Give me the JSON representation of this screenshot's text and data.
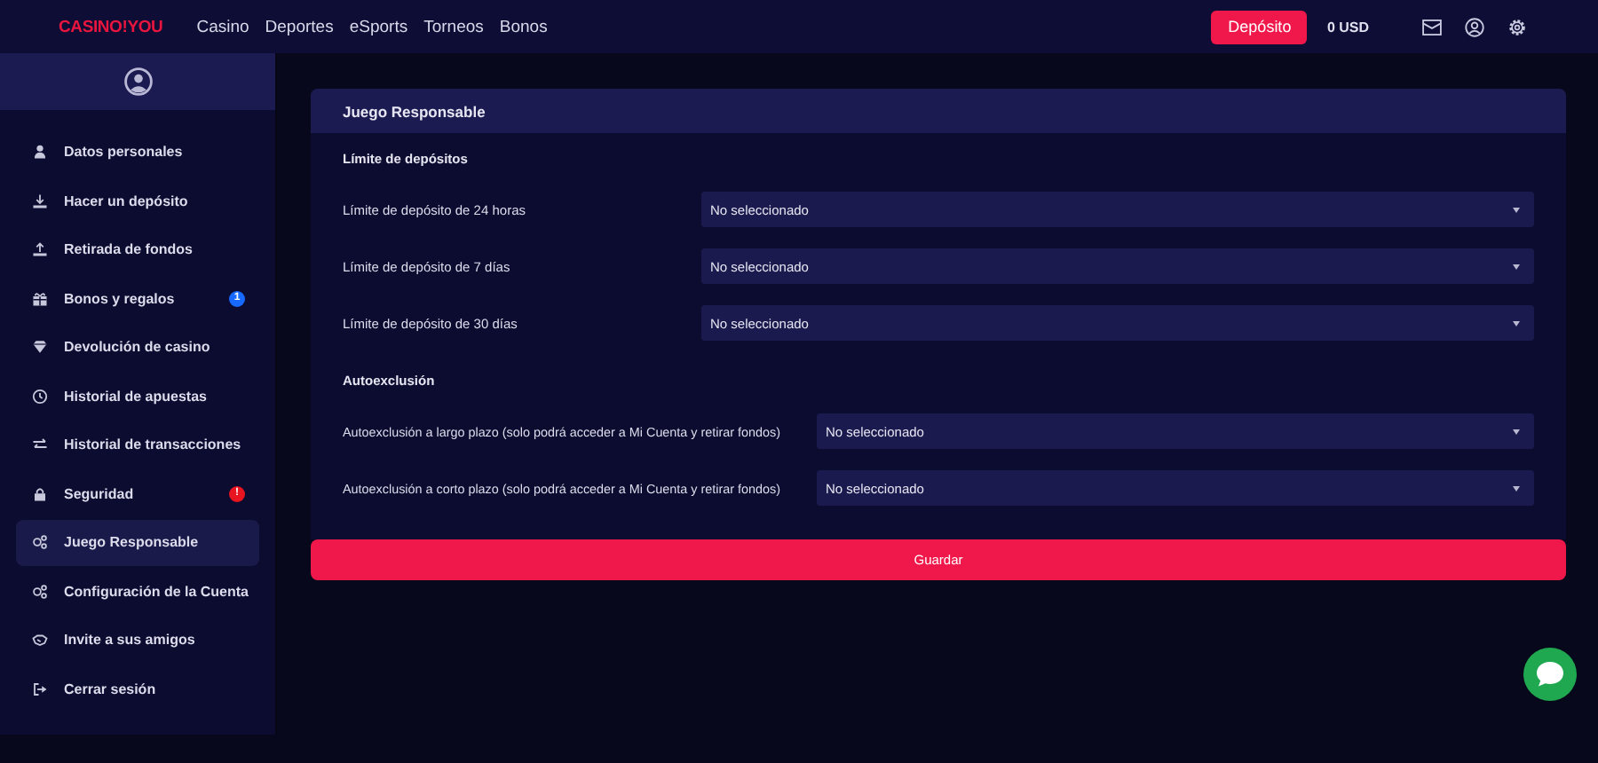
{
  "header": {
    "logo": "CASINO!YOU",
    "nav": [
      "Casino",
      "Deportes",
      "eSports",
      "Torneos",
      "Bonos"
    ],
    "deposit_button": "Depósito",
    "balance": "0 USD"
  },
  "sidebar": {
    "items": [
      {
        "label": "Datos personales",
        "selected": false
      },
      {
        "label": "Hacer un depósito",
        "selected": false
      },
      {
        "label": "Retirada de fondos",
        "selected": false
      },
      {
        "label": "Bonos y regalos",
        "selected": false,
        "badge": {
          "text": "1",
          "color": "#1769ff"
        }
      },
      {
        "label": "Devolución de casino",
        "selected": false
      },
      {
        "label": "Historial de apuestas",
        "selected": false
      },
      {
        "label": "Historial de transacciones",
        "selected": false
      },
      {
        "label": "Seguridad",
        "selected": false,
        "badge": {
          "text": "!",
          "color": "#e8141f"
        }
      },
      {
        "label": "Juego Responsable",
        "selected": true
      },
      {
        "label": "Configuración de la Cuenta",
        "selected": false
      },
      {
        "label": "Invite a sus amigos",
        "selected": false
      },
      {
        "label": "Cerrar sesión",
        "selected": false
      }
    ]
  },
  "panel": {
    "title": "Juego Responsable",
    "sections": [
      {
        "title": "Límite de depósitos",
        "fields": [
          {
            "label": "Límite de depósito de 24 horas",
            "value": "No seleccionado"
          },
          {
            "label": "Límite de depósito de 7 días",
            "value": "No seleccionado"
          },
          {
            "label": "Límite de depósito de 30 días",
            "value": "No seleccionado"
          }
        ]
      },
      {
        "title": "Autoexclusión",
        "fields": [
          {
            "label": "Autoexclusión a largo plazo (solo podrá acceder a Mi Cuenta y retirar fondos)",
            "value": "No seleccionado"
          },
          {
            "label": "Autoexclusión a corto plazo (solo podrá acceder a Mi Cuenta y retirar fondos)",
            "value": "No seleccionado"
          }
        ]
      }
    ],
    "save_button": "Guardar"
  }
}
